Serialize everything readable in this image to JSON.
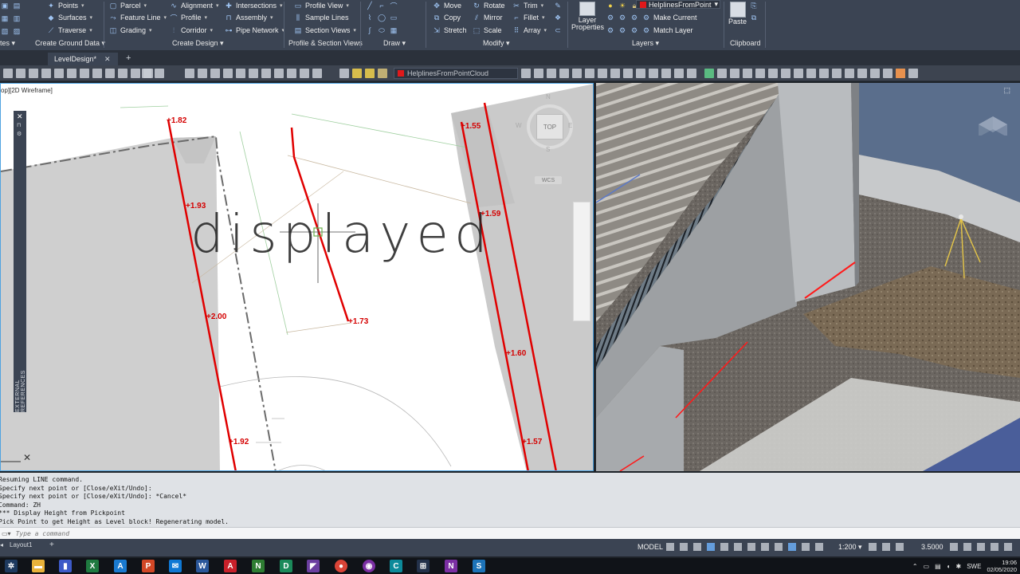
{
  "ribbon": {
    "col1": [
      "Points",
      "Surfaces",
      "Traverse"
    ],
    "col2": [
      "Parcel",
      "Feature Line",
      "Grading"
    ],
    "col3": [
      "Alignment",
      "Profile",
      "Corridor"
    ],
    "col4": [
      "Intersections",
      "Assembly",
      "Pipe Network"
    ],
    "col5": [
      "Profile View",
      "Sample Lines",
      "Section Views"
    ],
    "modify1": [
      "Move",
      "Copy",
      "Stretch"
    ],
    "modify2": [
      "Rotate",
      "Mirror",
      "Scale"
    ],
    "modify3": [
      "Trim",
      "Fillet",
      "Array"
    ],
    "layers_row": [
      "Make Current",
      "Match Layer"
    ],
    "layer_name": "HelplinesFromPoint",
    "layer_properties": "Layer Properties",
    "paste": "Paste",
    "panel_titles": {
      "create_ground_data": "Create Ground Data",
      "create_design": "Create Design",
      "profile_section": "Profile & Section Views",
      "draw": "Draw",
      "modify": "Modify",
      "layers": "Layers",
      "clipboard": "Clipboard"
    },
    "left_cut": "tes"
  },
  "tabs": {
    "active": "LevelDesign*",
    "close": "✕",
    "add": "+"
  },
  "toolbar": {
    "layer_dropdown": "HelplinesFromPointCloud"
  },
  "drawing": {
    "viewport_label": "op][2D Wireframe]",
    "overlay_text": "displayed",
    "levels": [
      "+1.82",
      "+1.93",
      "+2.00",
      "+1.92",
      "+1.73",
      "+1.55",
      "+1.59",
      "+1.60",
      "+1.57"
    ],
    "viewcube": {
      "top": "TOP",
      "north": "N",
      "south": "S",
      "west": "W",
      "east": "E",
      "wcs": "WCS"
    },
    "palette_label": "EXTERNAL REFERENCES"
  },
  "command": {
    "history": [
      "Resuming LINE command.",
      "Specify next point or [Close/eXit/Undo]:",
      "Specify next point or [Close/eXit/Undo]: *Cancel*",
      "Command: ZH",
      "*** Display Height from Pickpoint",
      "Pick Point to get Height as Level block! Regenerating model."
    ],
    "placeholder": "Type a command"
  },
  "status": {
    "layout": "Layout1",
    "model": "MODEL",
    "scale": "1:200",
    "value": "3.5000"
  },
  "taskbar": {
    "lang": "SWE",
    "time": "19:06",
    "date": "02/05/2020"
  },
  "colors": {
    "ribbon": "#3b4453",
    "level_red": "#d40000",
    "accent_blue": "#4fa3e0"
  }
}
